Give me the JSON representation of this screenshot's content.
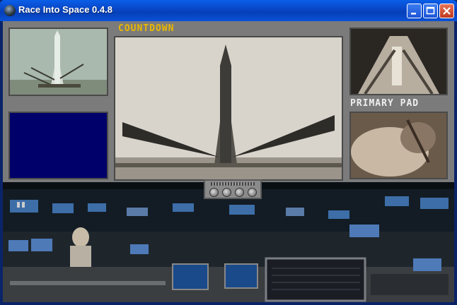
{
  "window": {
    "title": "Race Into Space 0.4.8"
  },
  "labels": {
    "countdown": "COUNTDOWN",
    "primary_pad": "PRIMARY PAD"
  },
  "colors": {
    "titlebar": "#0848C8",
    "panel": "#7b7b7b",
    "label_accent": "#E8B800",
    "blank_monitor": "#00006A"
  }
}
